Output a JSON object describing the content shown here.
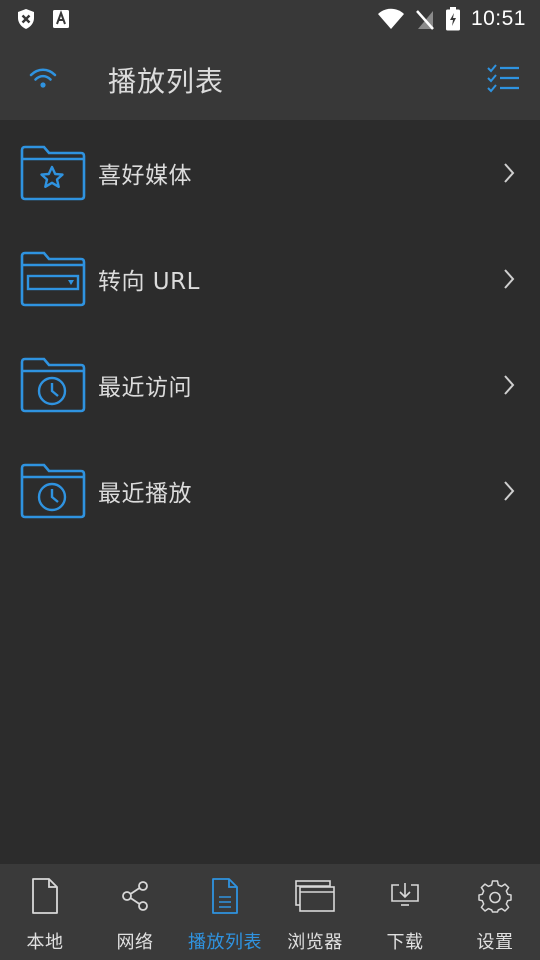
{
  "status_bar": {
    "time": "10:51",
    "icons": [
      "shield-x-icon",
      "font-a-icon",
      "wifi-icon",
      "no-signal-icon",
      "battery-charging-icon"
    ]
  },
  "app_bar": {
    "title": "播放列表",
    "left_icon": "wifi-icon",
    "right_icon": "checklist-icon"
  },
  "list": {
    "items": [
      {
        "label": "喜好媒体",
        "icon": "folder-star-icon"
      },
      {
        "label": "转向 URL",
        "icon": "folder-url-icon"
      },
      {
        "label": "最近访问",
        "icon": "folder-clock-icon"
      },
      {
        "label": "最近播放",
        "icon": "folder-clock-icon"
      }
    ]
  },
  "bottom_nav": {
    "active": "播放列表",
    "items": [
      {
        "label": "本地",
        "icon": "file-icon"
      },
      {
        "label": "网络",
        "icon": "share-icon"
      },
      {
        "label": "播放列表",
        "icon": "document-list-icon"
      },
      {
        "label": "浏览器",
        "icon": "browser-windows-icon"
      },
      {
        "label": "下载",
        "icon": "download-tray-icon"
      },
      {
        "label": "设置",
        "icon": "gear-icon"
      }
    ]
  },
  "colors": {
    "accent": "#2f93e0",
    "background": "#2c2c2c",
    "bar": "#383838",
    "text": "#dcdcdc"
  }
}
